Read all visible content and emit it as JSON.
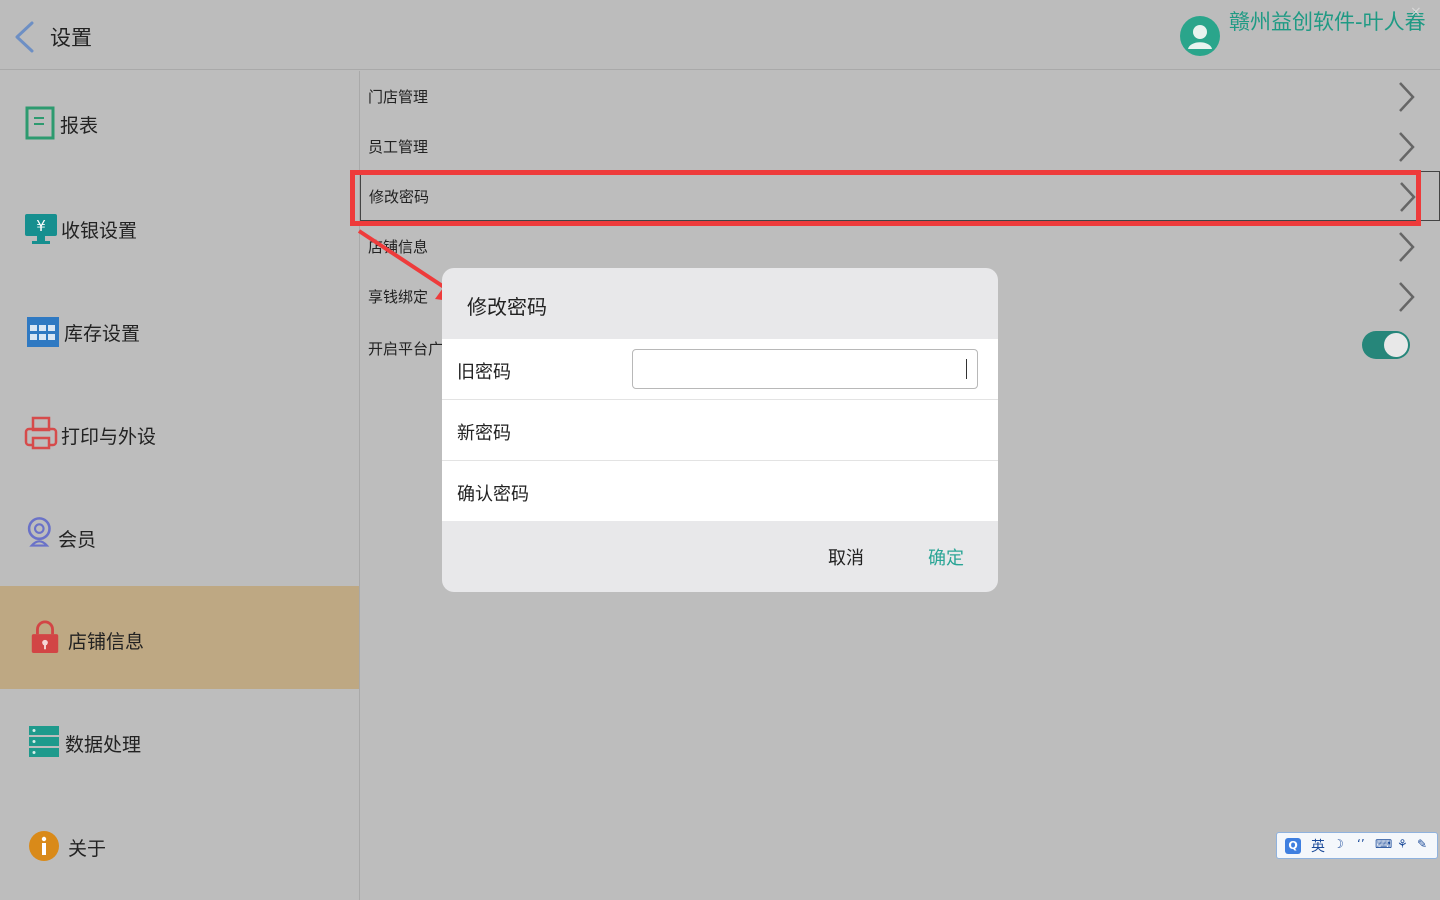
{
  "header": {
    "title": "设置",
    "user_name": "赣州益创软件-叶人春",
    "close_glyph": "×"
  },
  "sidebar": {
    "items": [
      {
        "label": "报表",
        "icon": "report-icon",
        "color": "#2d9a6f"
      },
      {
        "label": "收银设置",
        "icon": "cashier-monitor-icon",
        "color": "#168f8f"
      },
      {
        "label": "库存设置",
        "icon": "inventory-grid-icon",
        "color": "#2f79c2"
      },
      {
        "label": "打印与外设",
        "icon": "printer-icon",
        "color": "#d64b4b"
      },
      {
        "label": "会员",
        "icon": "member-webcam-icon",
        "color": "#6a72c8"
      },
      {
        "label": "店铺信息",
        "icon": "lock-icon",
        "color": "#d24545"
      },
      {
        "label": "数据处理",
        "icon": "database-icon",
        "color": "#1e9a8c"
      },
      {
        "label": "关于",
        "icon": "info-icon",
        "color": "#d98a19"
      }
    ],
    "active_index": 5
  },
  "content": {
    "rows": [
      {
        "label": "门店管理"
      },
      {
        "label": "员工管理"
      },
      {
        "label": "修改密码"
      },
      {
        "label": "店铺信息"
      },
      {
        "label": "享钱绑定"
      },
      {
        "label": "开启平台广"
      }
    ],
    "toggle_on": true
  },
  "dialog": {
    "title": "修改密码",
    "fields": [
      {
        "label": "旧密码",
        "value": ""
      },
      {
        "label": "新密码"
      },
      {
        "label": "确认密码"
      }
    ],
    "cancel": "取消",
    "ok": "确定"
  },
  "ime": {
    "mode": "英",
    "q": "Q"
  },
  "colors": {
    "accent": "#2aa596",
    "highlight": "#ee3b3b",
    "active_sidebar": "#bea883"
  }
}
